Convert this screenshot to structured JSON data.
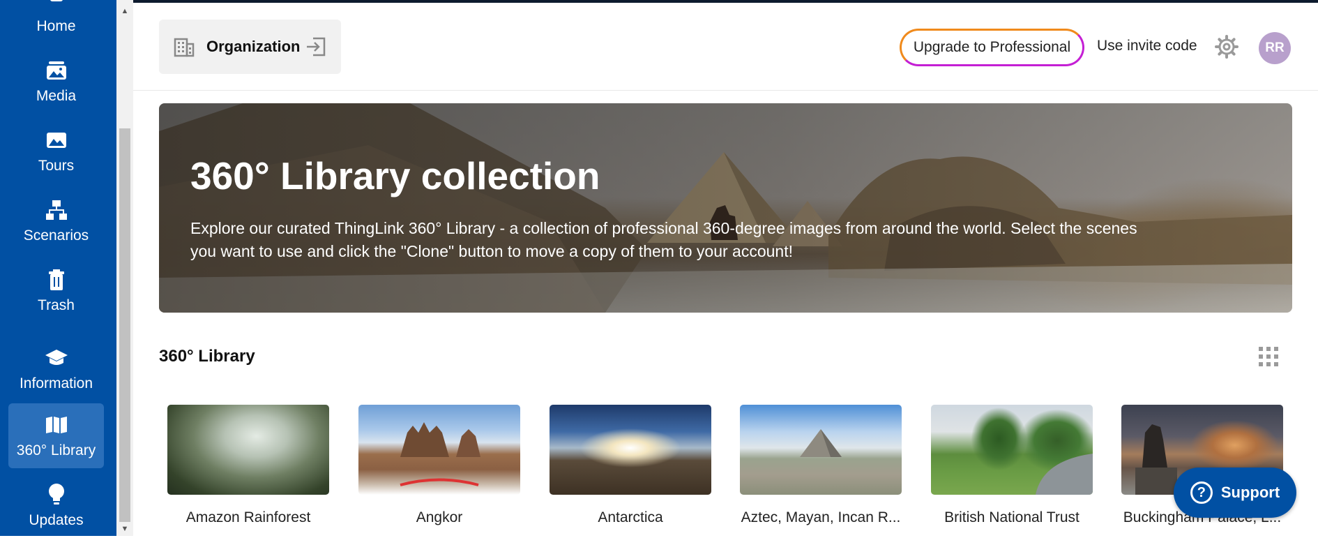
{
  "sidebar": {
    "items": [
      {
        "label": "Home",
        "icon": "home-icon"
      },
      {
        "label": "Media",
        "icon": "media-icon"
      },
      {
        "label": "Tours",
        "icon": "tours-icon"
      },
      {
        "label": "Scenarios",
        "icon": "scenarios-icon"
      },
      {
        "label": "Trash",
        "icon": "trash-icon"
      },
      {
        "label": "Information",
        "icon": "information-icon"
      },
      {
        "label": "360° Library",
        "icon": "library-icon",
        "active": true
      },
      {
        "label": "Updates",
        "icon": "lightbulb-icon"
      }
    ]
  },
  "header": {
    "organization_label": "Organization",
    "upgrade_label": "Upgrade to Professional",
    "invite_label": "Use invite code",
    "avatar_initials": "RR"
  },
  "hero": {
    "title": "360° Library collection",
    "description": "Explore our curated ThingLink 360° Library - a collection of professional 360-degree images from around the world. Select the scenes you want to use and click the \"Clone\" button to move a copy of them to your account!"
  },
  "library": {
    "title": "360° Library",
    "items": [
      {
        "label": "Amazon Rainforest"
      },
      {
        "label": "Angkor"
      },
      {
        "label": "Antarctica"
      },
      {
        "label": "Aztec, Mayan, Incan R..."
      },
      {
        "label": "British National Trust"
      },
      {
        "label": "Buckingham Palace, L..."
      }
    ]
  },
  "support": {
    "label": "Support"
  },
  "colors": {
    "sidebar": "#0150a3",
    "sidebar_active": "#2a6fba",
    "avatar": "#b8a0cc",
    "upgrade_gradient_start": "#f08a1c",
    "upgrade_gradient_end": "#c41fd4"
  }
}
